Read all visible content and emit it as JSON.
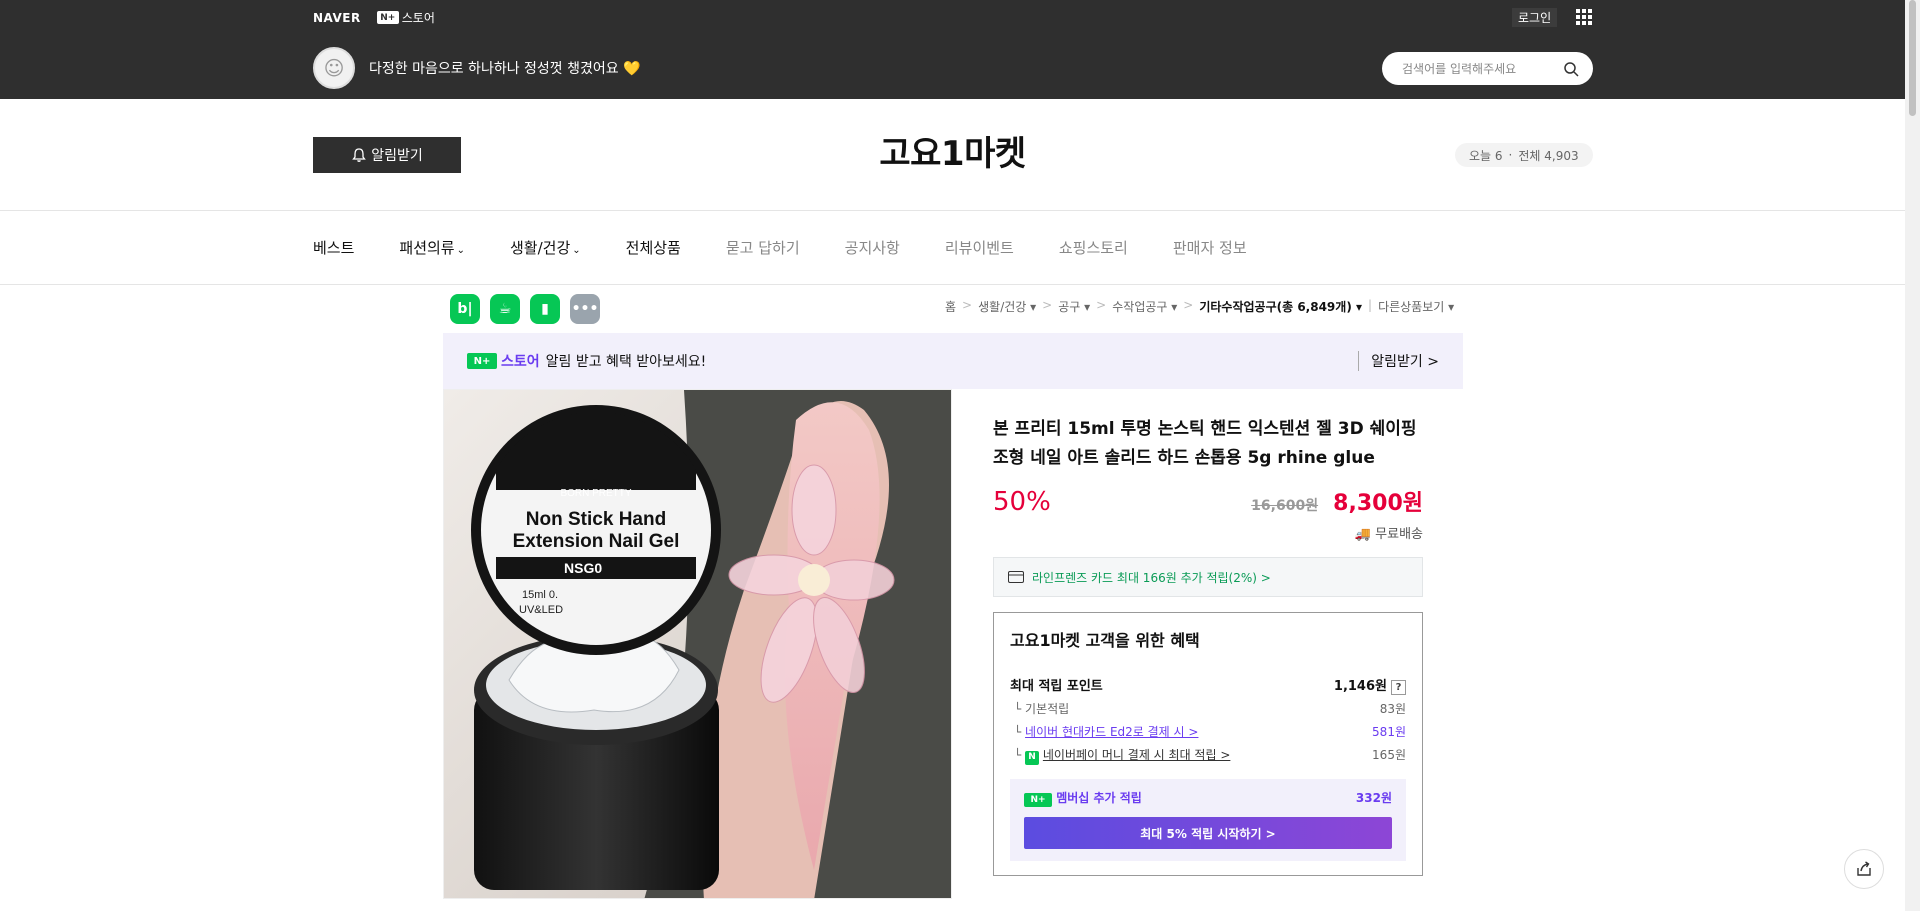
{
  "topbar": {
    "naver_label": "NAVER",
    "store_badge": "N+",
    "store_label": "스토어",
    "login_label": "로그인",
    "tagline": "다정한 마음으로 하나하나 정성껏 챙겼어요",
    "tagline_emoji": "💛",
    "search_placeholder": "검색어를 입력해주세요"
  },
  "store": {
    "alarm_label": "알림받기",
    "title": "고요1마켓",
    "today_label": "오늘 6",
    "total_label": "전체 4,903"
  },
  "nav": {
    "items": [
      {
        "label": "베스트"
      },
      {
        "label": "패션의류"
      },
      {
        "label": "생활/건강"
      },
      {
        "label": "전체상품"
      },
      {
        "label": "묻고 답하기"
      },
      {
        "label": "공지사항"
      },
      {
        "label": "리뷰이벤트"
      },
      {
        "label": "쇼핑스토리"
      },
      {
        "label": "판매자 정보"
      }
    ]
  },
  "breadcrumb": {
    "home": "홈",
    "c1": "생활/건강",
    "c2": "공구",
    "c3": "수작업공구",
    "c4": "기타수작업공구(총 6,849개)",
    "other": "다른상품보기"
  },
  "banner": {
    "store_label": "스토어",
    "text": "알림 받고 혜택 받아보세요!",
    "right_label": "알림받기 >"
  },
  "product": {
    "title": "본 프리티 15ml 투명 논스틱 핸드 익스텐션 젤 3D 쉐이핑 조형 네일 아트 솔리드 하드 손톱용 5g rhine glue",
    "discount": "50%",
    "original_price": "16,600원",
    "sale_price": "8,300원",
    "shipping": "무료배송",
    "card_promo": "라인프렌즈 카드 최대 166원 추가 적립(2%) >",
    "image_brand": "BORN PRETTY",
    "image_line1": "Non Stick Hand",
    "image_line2": "Extension Nail Gel",
    "image_code": "NSG0",
    "image_spec1": "15ml 0.",
    "image_spec2": "UV&LED"
  },
  "benefit": {
    "title": "고요1마켓 고객을 위한 혜택",
    "max_label": "최대 적립 포인트",
    "max_value": "1,146원",
    "basic_label": "기본적립",
    "basic_value": "83원",
    "hyundai_label": "네이버 현대카드 Ed2로 결제 시 >",
    "hyundai_value": "581원",
    "npay_label": "네이버페이 머니 결제 시 최대 적립 >",
    "npay_value": "165원",
    "member_label": "멤버십 추가 적립",
    "member_value": "332원",
    "member_button": "최대 5% 적립 시작하기 >"
  },
  "colors": {
    "topbar": "#2f2f2f",
    "sale_red": "#e5003a",
    "naver_green": "#06c755",
    "membership_purple": "#6a3cf0"
  }
}
